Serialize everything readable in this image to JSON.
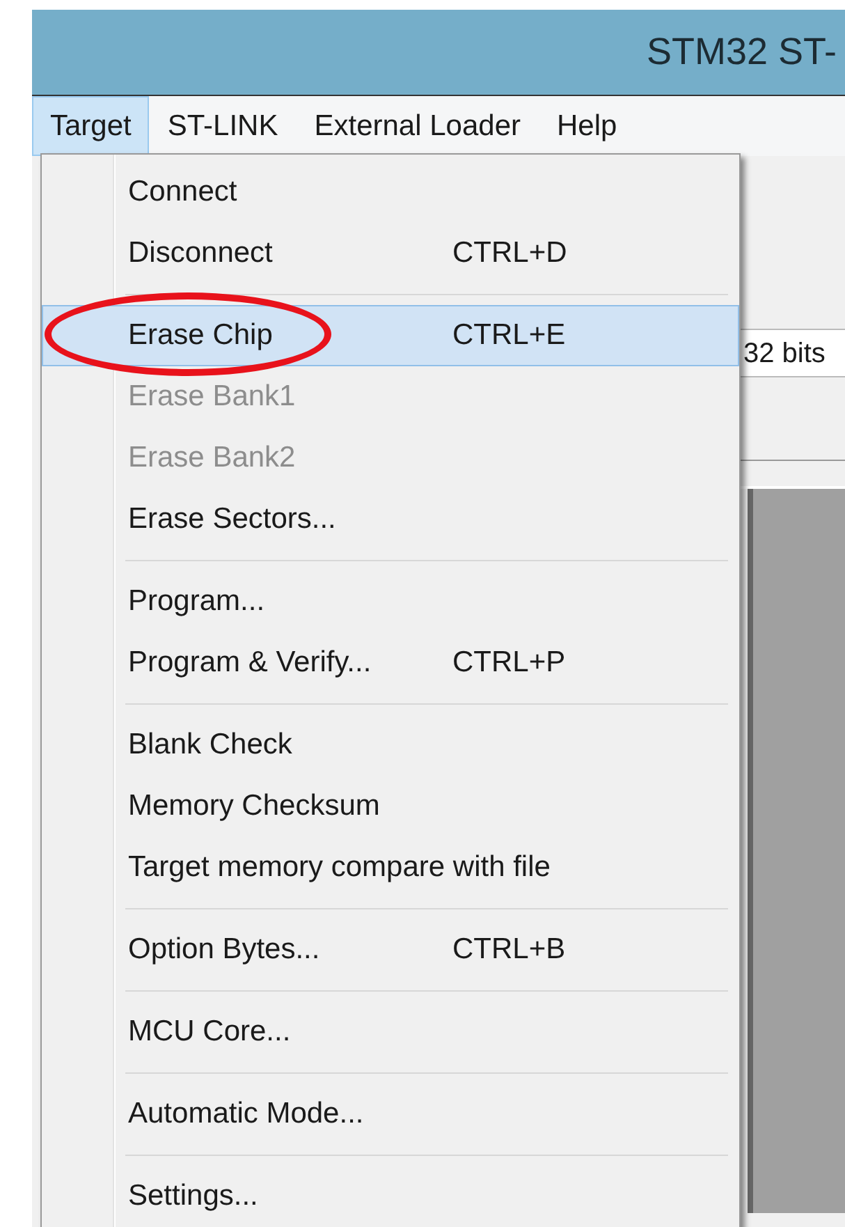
{
  "window": {
    "title": "STM32 ST-"
  },
  "menu_bar": [
    {
      "label": "Target",
      "selected": true
    },
    {
      "label": "ST-LINK",
      "selected": false
    },
    {
      "label": "External Loader",
      "selected": false
    },
    {
      "label": "Help",
      "selected": false
    }
  ],
  "background_field": {
    "value": "32 bits"
  },
  "dropdown": {
    "groups": [
      [
        {
          "label": "Connect",
          "selected": false,
          "disabled": false,
          "circled": false
        },
        {
          "label": "Disconnect",
          "shortcut": "CTRL+D",
          "selected": false,
          "disabled": false,
          "circled": false
        }
      ],
      [
        {
          "label": "Erase Chip",
          "shortcut": "CTRL+E",
          "selected": true,
          "disabled": false,
          "circled": true
        },
        {
          "label": "Erase Bank1",
          "selected": false,
          "disabled": true,
          "circled": false
        },
        {
          "label": "Erase Bank2",
          "selected": false,
          "disabled": true,
          "circled": false
        },
        {
          "label": "Erase Sectors...",
          "selected": false,
          "disabled": false,
          "circled": false
        }
      ],
      [
        {
          "label": "Program...",
          "selected": false,
          "disabled": false,
          "circled": false
        },
        {
          "label": "Program & Verify...",
          "shortcut": "CTRL+P",
          "selected": false,
          "disabled": false,
          "circled": false
        }
      ],
      [
        {
          "label": "Blank Check",
          "selected": false,
          "disabled": false,
          "circled": false
        },
        {
          "label": "Memory Checksum",
          "selected": false,
          "disabled": false,
          "circled": false
        },
        {
          "label": "Target memory compare with file",
          "selected": false,
          "disabled": false,
          "circled": false
        }
      ],
      [
        {
          "label": "Option Bytes...",
          "shortcut": "CTRL+B",
          "selected": false,
          "disabled": false,
          "circled": false
        }
      ],
      [
        {
          "label": "MCU Core...",
          "selected": false,
          "disabled": false,
          "circled": false
        }
      ],
      [
        {
          "label": "Automatic Mode...",
          "selected": false,
          "disabled": false,
          "circled": false
        }
      ],
      [
        {
          "label": "Settings...",
          "selected": false,
          "disabled": false,
          "circled": false
        }
      ]
    ]
  }
}
